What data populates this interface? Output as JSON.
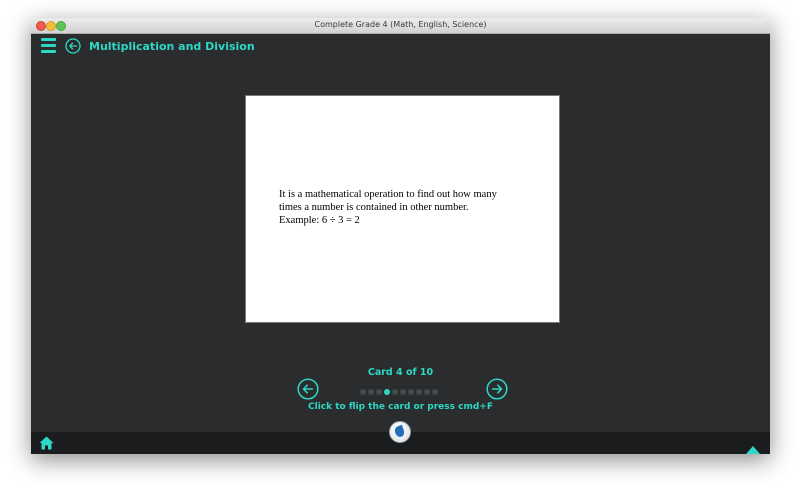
{
  "window": {
    "title": "Complete Grade 4 (Math, English, Science)"
  },
  "header": {
    "title": "Multiplication and Division"
  },
  "card": {
    "lines": [
      "It is a mathematical operation to find out how many",
      "times a number is contained in other number.",
      "Example: 6 ÷ 3 = 2"
    ]
  },
  "navigation": {
    "counter": "Card 4 of 10",
    "current": 4,
    "total": 10,
    "hint": "Click to flip the card  or press cmd+F"
  },
  "icons": [
    "menu-icon",
    "back-arrow-icon",
    "prev-arrow-icon",
    "next-arrow-icon",
    "home-icon",
    "up-arrow-icon",
    "app-logo-icon"
  ],
  "colors": {
    "accent": "#2ed8c6",
    "background": "#2a2c2d",
    "bottom_bar": "#1b1c1d"
  }
}
